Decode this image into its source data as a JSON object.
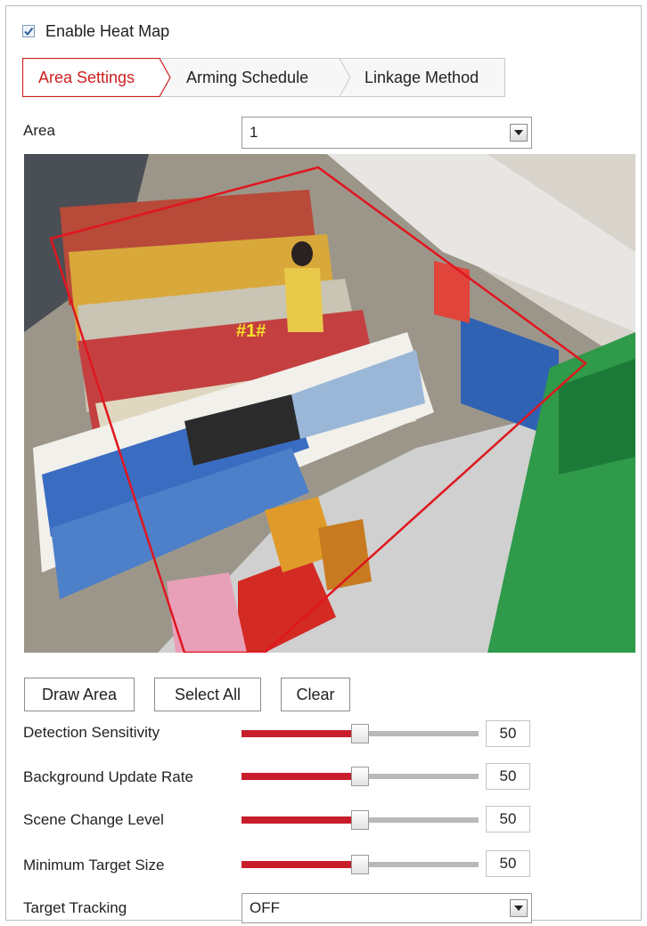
{
  "enable_heat_map": {
    "label": "Enable Heat Map",
    "checked": true
  },
  "tabs": [
    {
      "label": "Area Settings",
      "active": true
    },
    {
      "label": "Arming Schedule",
      "active": false
    },
    {
      "label": "Linkage Method",
      "active": false
    }
  ],
  "area": {
    "label": "Area",
    "value": "1"
  },
  "video": {
    "region_label": "#1#"
  },
  "buttons": {
    "draw_area": "Draw Area",
    "select_all": "Select All",
    "clear": "Clear"
  },
  "params": [
    {
      "label": "Detection Sensitivity",
      "value": "50",
      "level_percent": 50
    },
    {
      "label": "Background Update Rate",
      "value": "50",
      "level_percent": 50
    },
    {
      "label": "Scene Change Level",
      "value": "50",
      "level_percent": 50
    },
    {
      "label": "Minimum Target Size",
      "value": "50",
      "level_percent": 50
    }
  ],
  "target_tracking": {
    "label": "Target Tracking",
    "value": "OFF"
  },
  "colors": {
    "accent": "#cc1f1f",
    "slider_fill": "#c81e2c",
    "region_outline": "#e0161e"
  }
}
